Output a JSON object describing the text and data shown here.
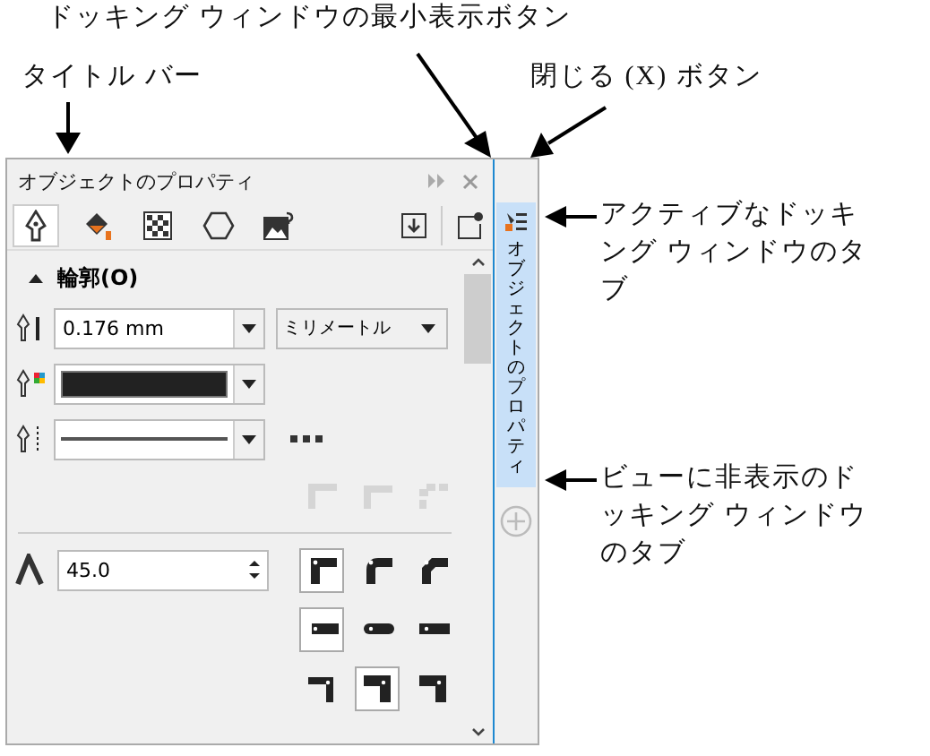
{
  "callouts": [
    {
      "text": "ドッキング ウィンドウの最小表示ボタン"
    },
    {
      "text": "タイトル バー"
    },
    {
      "text": "閉じる (X) ボタン"
    },
    {
      "text": "アクティブなドッキング ウィンドウのタブ"
    },
    {
      "text": "ビューに非表示のドッキング ウィンドウのタブ"
    }
  ],
  "window": {
    "title": "オブジェクトのプロパティ"
  },
  "tabs": [
    {
      "kind": "outline",
      "selected": true
    },
    {
      "kind": "fill",
      "selected": false
    },
    {
      "kind": "transparency",
      "selected": false
    },
    {
      "kind": "shape",
      "selected": false
    },
    {
      "kind": "image",
      "selected": false
    }
  ],
  "section": {
    "title": "輪郭(O)",
    "expanded": true
  },
  "width_field": {
    "value": "0.176 mm"
  },
  "units": {
    "value": "ミリメートル"
  },
  "miter_field": {
    "value": "45.0"
  },
  "option_rows": [
    {
      "kind": "corner",
      "disabled": true,
      "options": [
        {
          "selected": false
        },
        {
          "selected": false
        },
        {
          "selected": false
        }
      ]
    },
    {
      "kind": "join",
      "disabled": false,
      "options": [
        {
          "selected": true
        },
        {
          "selected": false
        },
        {
          "selected": false
        }
      ]
    },
    {
      "kind": "cap",
      "disabled": false,
      "options": [
        {
          "selected": true
        },
        {
          "selected": false
        },
        {
          "selected": false
        }
      ]
    },
    {
      "kind": "position",
      "disabled": false,
      "options": [
        {
          "selected": false
        },
        {
          "selected": true
        },
        {
          "selected": false
        }
      ]
    }
  ],
  "docker_tabs": [
    {
      "label": "オブジェクトのプロパティ",
      "selected": true
    }
  ]
}
